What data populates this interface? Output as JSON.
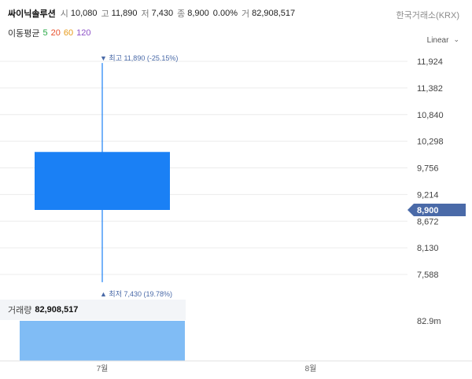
{
  "header": {
    "stock_name": "싸이닉솔루션",
    "open_label": "시",
    "open": "10,080",
    "high_label": "고",
    "high": "11,890",
    "low_label": "저",
    "low": "7,430",
    "close_label": "종",
    "close": "8,900",
    "change": "0.00%",
    "volume_label": "거",
    "volume": "82,908,517",
    "exchange": "한국거래소(KRX)"
  },
  "moving_average": {
    "label": "이동평균",
    "periods": [
      {
        "value": "5",
        "color": "#27a844"
      },
      {
        "value": "20",
        "color": "#e8502d"
      },
      {
        "value": "60",
        "color": "#e69a1a"
      },
      {
        "value": "120",
        "color": "#8e52c7"
      }
    ]
  },
  "scale_toggle": {
    "label": "Linear",
    "icon": "chevron-down-icon"
  },
  "annotations": {
    "high": "▼ 최고 11,890 (-25.15%)",
    "low": "▲ 최저 7,430 (19.78%)"
  },
  "volume_panel": {
    "label": "거래량",
    "value": "82,908,517",
    "axis_label": "82.9m"
  },
  "colors": {
    "candle": "#1a80f5",
    "volume": "#80bcf5",
    "price_tag": "#4a6aa8",
    "grid": "#ececec"
  },
  "chart_data": {
    "type": "candlestick",
    "x_ticks": [
      "7월",
      "8월"
    ],
    "candles": [
      {
        "period": "7월",
        "open": 10080,
        "high": 11890,
        "low": 7430,
        "close": 8900,
        "volume": 82908517
      }
    ],
    "y_ticks": [
      11924,
      11382,
      10840,
      10298,
      9756,
      9214,
      8672,
      8130,
      7588
    ],
    "y_tick_labels": [
      "11,924",
      "11,382",
      "10,840",
      "10,298",
      "9,756",
      "9,214",
      "8,672",
      "8,130",
      "7,588"
    ],
    "current_price": 8900,
    "current_price_label": "8,900",
    "ylim": [
      7250,
      12200
    ],
    "volume_max": 82908517
  }
}
